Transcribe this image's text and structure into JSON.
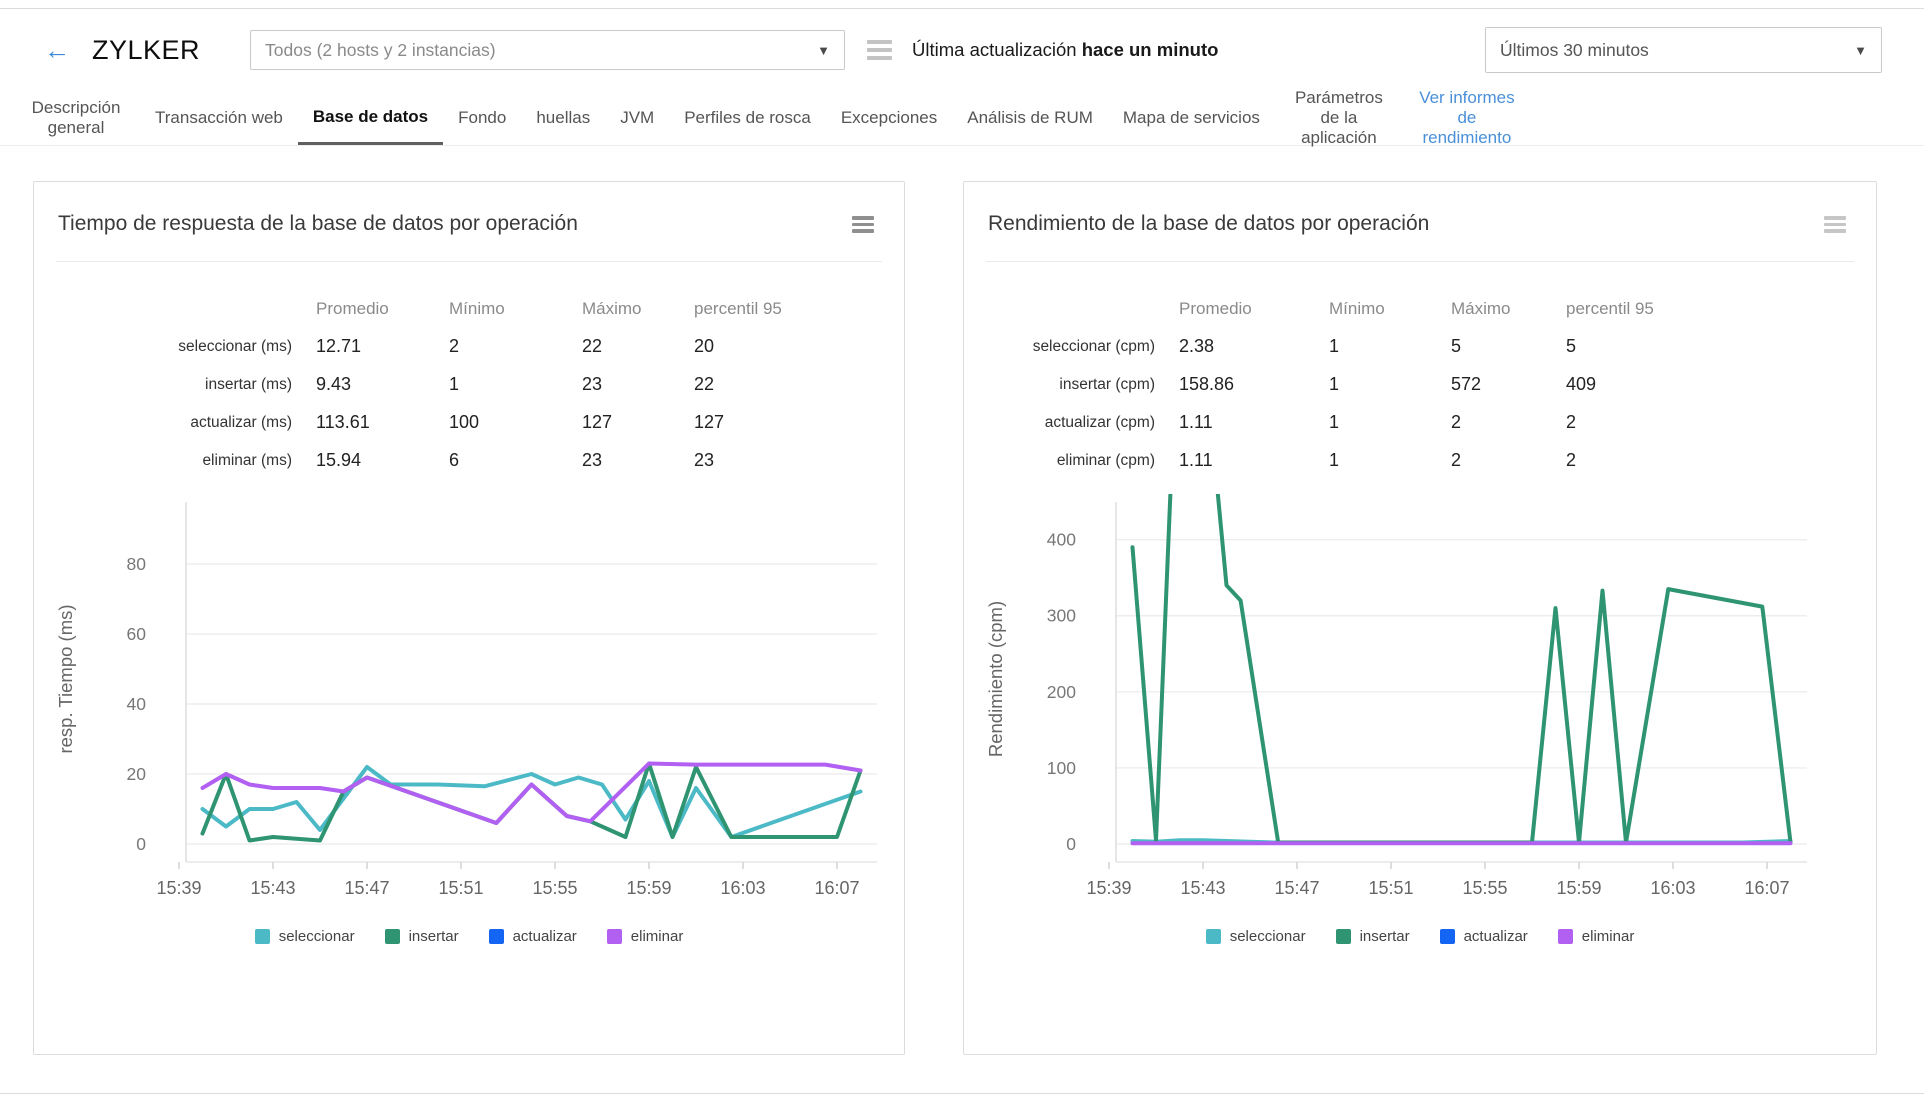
{
  "header": {
    "app_title": "ZYLKER",
    "scope_selector": {
      "value": "Todos (2 hosts y 2 instancias)"
    },
    "last_update": {
      "label": "Última actualización",
      "value": "hace un minuto"
    },
    "time_range": {
      "value": "Últimos 30 minutos"
    }
  },
  "tabs": [
    {
      "label": "Descripción general",
      "active": false
    },
    {
      "label": "Transacción web",
      "active": false
    },
    {
      "label": "Base de datos",
      "active": true
    },
    {
      "label": "Fondo",
      "active": false
    },
    {
      "label": "huellas",
      "active": false
    },
    {
      "label": "JVM",
      "active": false
    },
    {
      "label": "Perfiles de rosca",
      "active": false
    },
    {
      "label": "Excepciones",
      "active": false
    },
    {
      "label": "Análisis de RUM",
      "active": false
    },
    {
      "label": "Mapa de servicios",
      "active": false
    },
    {
      "label": "Parámetros de la aplicación",
      "active": false
    },
    {
      "label": "Ver informes de rendimiento",
      "active": false,
      "link": true
    }
  ],
  "panels": [
    {
      "table": {
        "columns": [
          "Promedio",
          "Mínimo",
          "Máximo",
          "percentil 95"
        ],
        "rows": [
          {
            "label": "seleccionar (ms)",
            "values": [
              "12.71",
              "2",
              "22",
              "20"
            ]
          },
          {
            "label": "insertar (ms)",
            "values": [
              "9.43",
              "1",
              "23",
              "22"
            ]
          },
          {
            "label": "actualizar (ms)",
            "values": [
              "113.61",
              "100",
              "127",
              "127"
            ]
          },
          {
            "label": "eliminar (ms)",
            "values": [
              "15.94",
              "6",
              "23",
              "23"
            ]
          }
        ]
      }
    },
    {
      "table": {
        "columns": [
          "Promedio",
          "Mínimo",
          "Máximo",
          "percentil 95"
        ],
        "rows": [
          {
            "label": "seleccionar (cpm)",
            "values": [
              "2.38",
              "1",
              "5",
              "5"
            ]
          },
          {
            "label": "insertar (cpm)",
            "values": [
              "158.86",
              "1",
              "572",
              "409"
            ]
          },
          {
            "label": "actualizar (cpm)",
            "values": [
              "1.11",
              "1",
              "2",
              "2"
            ]
          },
          {
            "label": "eliminar (cpm)",
            "values": [
              "1.11",
              "1",
              "2",
              "2"
            ]
          }
        ]
      }
    }
  ],
  "chart_data": [
    {
      "type": "line",
      "title": "Tiempo de respuesta de la base de datos por operación",
      "ylabel": "resp. Tiempo (ms)",
      "x_ticks": [
        "15:39",
        "15:43",
        "15:47",
        "15:51",
        "15:55",
        "15:59",
        "16:03",
        "16:07"
      ],
      "y_ticks": [
        0,
        20,
        40,
        60,
        80
      ],
      "ylim": [
        0,
        100
      ],
      "grid": true,
      "legend_position": "bottom",
      "x_unit": "minutes_after_15:39",
      "series": [
        {
          "name": "seleccionar",
          "color": "#4cbac6",
          "points": [
            [
              1,
              10
            ],
            [
              2,
              5
            ],
            [
              3,
              10
            ],
            [
              4,
              10
            ],
            [
              5,
              12
            ],
            [
              6,
              4
            ],
            [
              8,
              22
            ],
            [
              9,
              17
            ],
            [
              11,
              17
            ],
            [
              13,
              16.5
            ],
            [
              15,
              20
            ],
            [
              16,
              17
            ],
            [
              17,
              19
            ],
            [
              18,
              17
            ],
            [
              19,
              7
            ],
            [
              20,
              18
            ],
            [
              21,
              2
            ],
            [
              22,
              16
            ],
            [
              23.5,
              2
            ],
            [
              29,
              15
            ]
          ]
        },
        {
          "name": "insertar",
          "color": "#2e9471",
          "points": [
            [
              1,
              3
            ],
            [
              2,
              20
            ],
            [
              3,
              1
            ],
            [
              4,
              2
            ],
            [
              5,
              1.5
            ],
            [
              6,
              1
            ],
            [
              7,
              15
            ],
            [
              8,
              19
            ],
            [
              13.5,
              6
            ],
            [
              15,
              17
            ],
            [
              16.5,
              8
            ],
            [
              17.5,
              6.5
            ],
            [
              19,
              2
            ],
            [
              20,
              23
            ],
            [
              21,
              2
            ],
            [
              22,
              22
            ],
            [
              23.5,
              2
            ],
            [
              28,
              2
            ],
            [
              29,
              21
            ]
          ]
        },
        {
          "name": "actualizar",
          "color": "#1565f5",
          "points": []
        },
        {
          "name": "eliminar",
          "color": "#b260f2",
          "points": [
            [
              1,
              16
            ],
            [
              2,
              20
            ],
            [
              3,
              17
            ],
            [
              4,
              16
            ],
            [
              5,
              16
            ],
            [
              6,
              16
            ],
            [
              7,
              15
            ],
            [
              8,
              19
            ],
            [
              13.5,
              6
            ],
            [
              15,
              17
            ],
            [
              16.5,
              8
            ],
            [
              17.5,
              6.5
            ],
            [
              20,
              23
            ],
            [
              22,
              22.7
            ],
            [
              27.5,
              22.7
            ],
            [
              29,
              21
            ]
          ]
        }
      ]
    },
    {
      "type": "line",
      "title": "Rendimiento de la base de datos por operación",
      "ylabel": "Rendimiento (cpm)",
      "x_ticks": [
        "15:39",
        "15:43",
        "15:47",
        "15:51",
        "15:55",
        "15:59",
        "16:03",
        "16:07"
      ],
      "y_ticks": [
        0,
        100,
        200,
        300,
        400
      ],
      "ylim": [
        0,
        460
      ],
      "grid": true,
      "legend_position": "bottom",
      "x_unit": "minutes_after_15:39",
      "series": [
        {
          "name": "seleccionar",
          "color": "#4cbac6",
          "points": [
            [
              1,
              4
            ],
            [
              2,
              3
            ],
            [
              3,
              5
            ],
            [
              4,
              5
            ],
            [
              5,
              4
            ],
            [
              6,
              3
            ],
            [
              7,
              2
            ],
            [
              18,
              2
            ],
            [
              27,
              2
            ],
            [
              29,
              4
            ]
          ]
        },
        {
          "name": "insertar",
          "color": "#2e9471",
          "points": [
            [
              1,
              390
            ],
            [
              2,
              5
            ],
            [
              2.8,
              600
            ],
            [
              4.2,
              600
            ],
            [
              5,
              340
            ],
            [
              5.6,
              320
            ],
            [
              7.2,
              2
            ],
            [
              18,
              2
            ],
            [
              19,
              310
            ],
            [
              20,
              2
            ],
            [
              21,
              333
            ],
            [
              22,
              2
            ],
            [
              23.8,
              335
            ],
            [
              27.8,
              312
            ],
            [
              29,
              2
            ]
          ]
        },
        {
          "name": "actualizar",
          "color": "#1565f5",
          "points": []
        },
        {
          "name": "eliminar",
          "color": "#b260f2",
          "points": [
            [
              1,
              1
            ],
            [
              29,
              1
            ]
          ]
        }
      ]
    }
  ]
}
